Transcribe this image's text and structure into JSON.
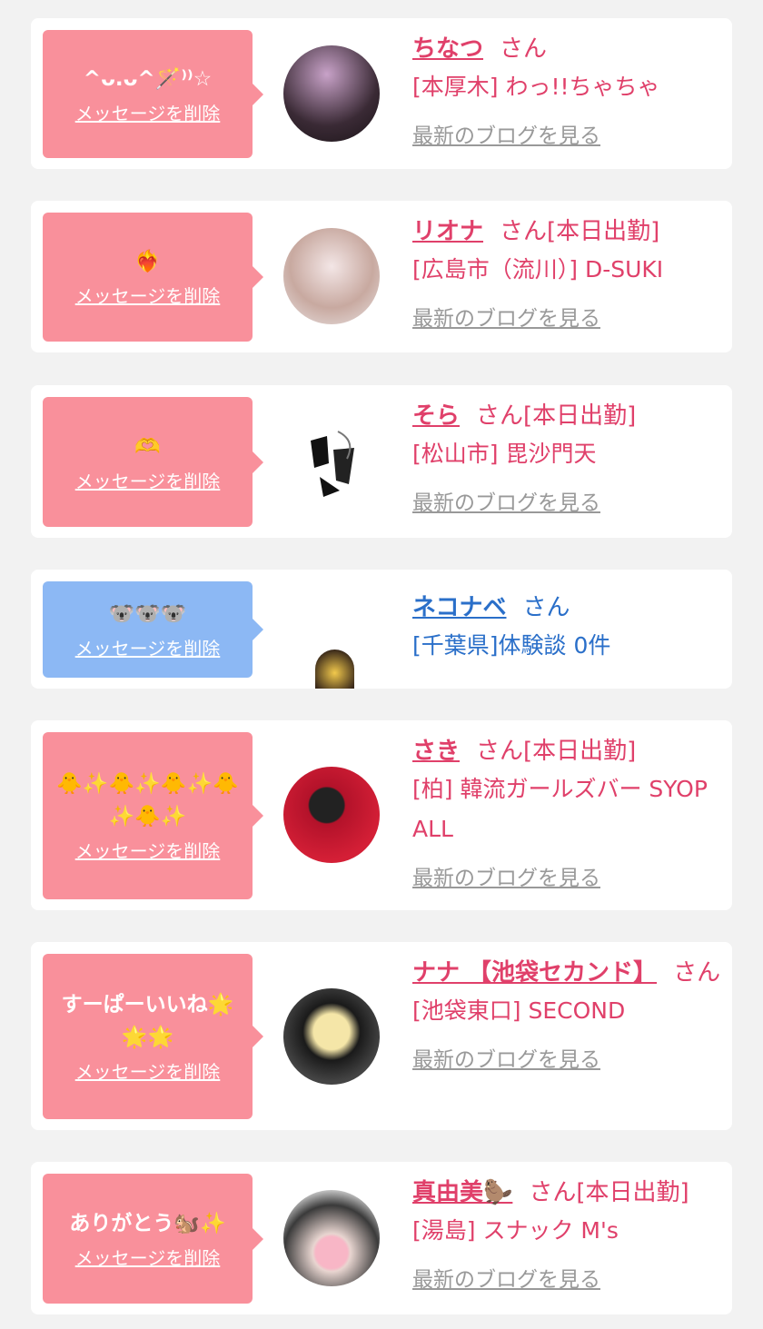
{
  "delete_label": "メッセージを削除",
  "blog_label": "最新のブログを見る",
  "san_label": "さん",
  "cards": [
    {
      "message": "^ᴗ.ᴗ^🪄⁾⁾☆",
      "name": "ちなつ",
      "suffix": "",
      "shop": "[本厚木] わっ!!ちゃちゃ"
    },
    {
      "message": "❤️‍🔥",
      "name": "リオナ",
      "suffix": "[本日出勤]",
      "shop": "[広島市（流川）] D-SUKI"
    },
    {
      "message": "🫶",
      "name": "そら",
      "suffix": "[本日出勤]",
      "shop": "[松山市] 毘沙門天"
    },
    {
      "message": "🐨🐨🐨",
      "name": "ネコナベ",
      "suffix": "",
      "shop": "[千葉県]体験談 0件"
    },
    {
      "message": "🐥✨🐥✨🐥✨🐥✨🐥✨",
      "name": "さき",
      "suffix": "[本日出勤]",
      "shop": "[柏] 韓流ガールズバー SYOPALL"
    },
    {
      "message": "すーぱーいいね🌟🌟🌟",
      "name": "ナナ 【池袋セカンド】",
      "suffix": "",
      "shop": "[池袋東口] SECOND"
    },
    {
      "message": "ありがとう🐿️✨",
      "name": "真由美🦫",
      "suffix": "[本日出勤]",
      "shop": "[湯島] スナック M's"
    }
  ],
  "colors": {
    "pink": "#f9909b",
    "blue": "#8cb8f4",
    "name_pink": "#e0406a",
    "name_blue": "#2a6fc9"
  }
}
